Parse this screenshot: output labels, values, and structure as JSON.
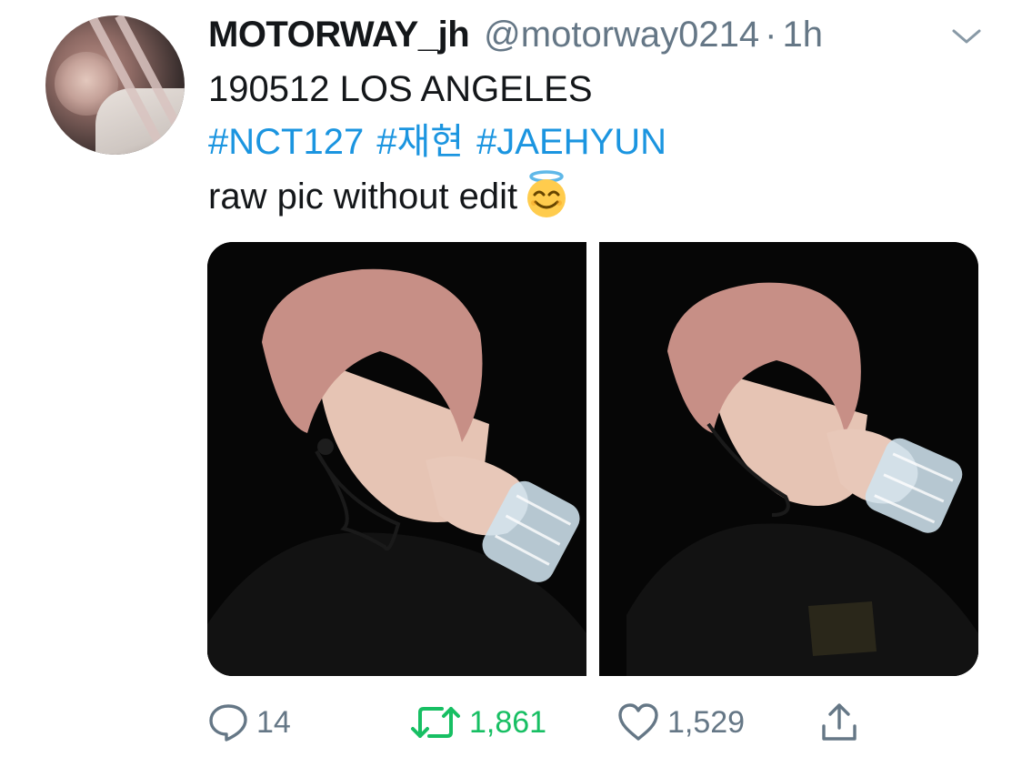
{
  "tweet": {
    "display_name": "MOTORWAY_jh",
    "handle": "@motorway0214",
    "separator": "·",
    "time": "1h",
    "line1": "190512 LOS ANGELES",
    "hashtags": [
      "#NCT127",
      "#재현",
      "#JAEHYUN"
    ],
    "line3": "raw pic without edit",
    "emoji": "smiling-face-with-halo"
  },
  "media": {
    "count": 2
  },
  "actions": {
    "reply_count": "14",
    "retweet_count": "1,861",
    "like_count": "1,529"
  },
  "colors": {
    "text": "#14171a",
    "secondary": "#657786",
    "link": "#1b95e0",
    "retweet_active": "#17bf63"
  }
}
